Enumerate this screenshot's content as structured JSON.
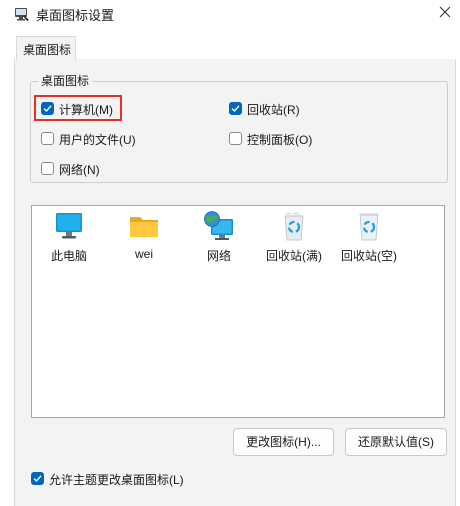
{
  "window": {
    "title": "桌面图标设置",
    "icon": "desktop-settings-icon",
    "close_icon": "close-icon"
  },
  "tabs": [
    {
      "label": "桌面图标"
    }
  ],
  "group": {
    "title": "桌面图标",
    "checkboxes": {
      "computer": {
        "label": "计算机(M)",
        "checked": true
      },
      "recycle_bin": {
        "label": "回收站(R)",
        "checked": true
      },
      "user_files": {
        "label": "用户的文件(U)",
        "checked": false
      },
      "control_panel": {
        "label": "控制面板(O)",
        "checked": false
      },
      "network": {
        "label": "网络(N)",
        "checked": false
      }
    }
  },
  "icons": [
    {
      "label": "此电脑",
      "icon": "monitor-icon"
    },
    {
      "label": "wei",
      "icon": "folder-icon"
    },
    {
      "label": "网络",
      "icon": "network-globe-icon"
    },
    {
      "label": "回收站(满)",
      "icon": "recycle-bin-full-icon"
    },
    {
      "label": "回收站(空)",
      "icon": "recycle-bin-empty-icon"
    }
  ],
  "buttons": {
    "change_icon": "更改图标(H)...",
    "restore_default": "还原默认值(S)"
  },
  "allow_themes": {
    "label": "允许主题更改桌面图标(L)",
    "checked": true
  },
  "colors": {
    "accent": "#0067c0",
    "highlight_border": "#e0302a",
    "panel_bg": "#f3f3f3"
  }
}
